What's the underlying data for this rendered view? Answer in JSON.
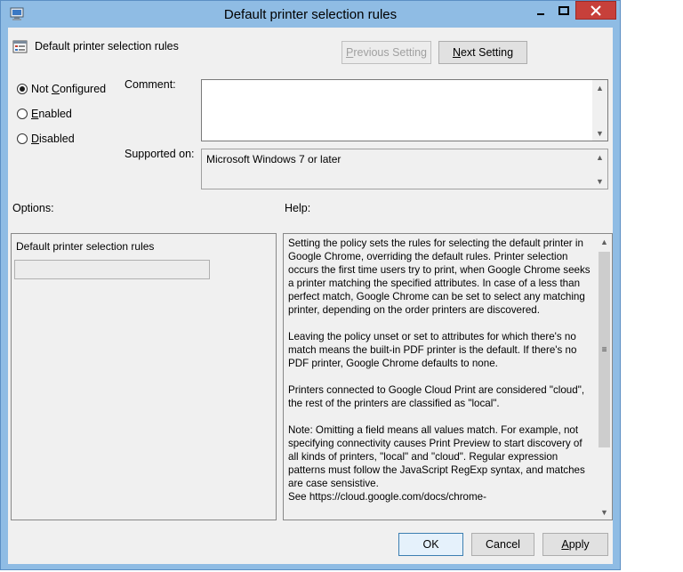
{
  "window": {
    "title": "Default printer selection rules"
  },
  "header": {
    "policy_name": "Default printer selection rules",
    "previous_label_pre": "",
    "previous_label_ul": "P",
    "previous_label_post": "revious Setting",
    "next_label_pre": "",
    "next_label_ul": "N",
    "next_label_post": "ext Setting"
  },
  "state": {
    "options": [
      {
        "pre": "Not ",
        "ul": "C",
        "post": "onfigured",
        "selected": true
      },
      {
        "pre": "",
        "ul": "E",
        "post": "nabled",
        "selected": false
      },
      {
        "pre": "",
        "ul": "D",
        "post": "isabled",
        "selected": false
      }
    ]
  },
  "comment": {
    "label": "Comment:",
    "value": ""
  },
  "supported": {
    "label": "Supported on:",
    "value": "Microsoft Windows 7 or later"
  },
  "options_panel": {
    "label": "Options:",
    "field_label": "Default printer selection rules",
    "field_value": ""
  },
  "help_panel": {
    "label": "Help:",
    "paragraphs": [
      "Setting the policy sets the rules for selecting the default printer in Google Chrome, overriding the default rules. Printer selection occurs the first time users try to print, when Google Chrome seeks a printer matching the specified attributes. In case of a less than perfect match, Google Chrome can be set to select any matching printer, depending on the order printers are discovered.",
      "Leaving the policy unset or set to attributes for which there's no match means the built-in PDF printer is the default. If there's no PDF printer, Google Chrome defaults to none.",
      "Printers connected to Google Cloud Print are considered \"cloud\", the rest of the printers are classified as \"local\".",
      "Note: Omitting a field means all values match. For example, not specifying connectivity causes Print Preview to start discovery of all kinds of printers, \"local\" and \"cloud\". Regular expression patterns must follow the JavaScript RegExp syntax, and matches are case sensistive.",
      "See https://cloud.google.com/docs/chrome-"
    ]
  },
  "footer": {
    "ok_label": "OK",
    "cancel_label": "Cancel",
    "apply_pre": "",
    "apply_ul": "A",
    "apply_post": "pply"
  }
}
